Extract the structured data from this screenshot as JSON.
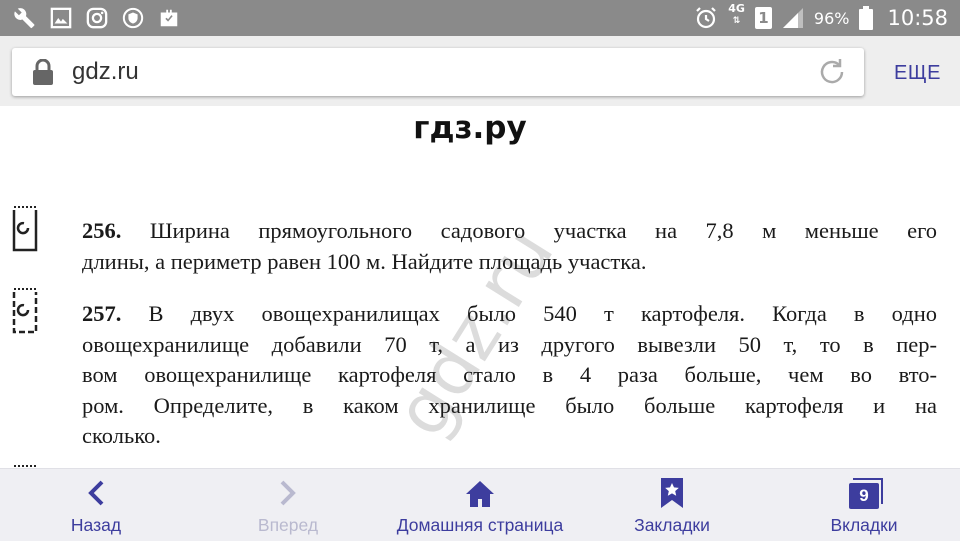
{
  "status_bar": {
    "network": "4G",
    "sim": "1",
    "battery": "96%",
    "time": "10:58",
    "icons": [
      "wrench-icon",
      "image-icon",
      "instagram-icon",
      "shield-icon",
      "briefcase-icon",
      "alarm-icon",
      "signal-icon",
      "battery-icon"
    ]
  },
  "toolbar": {
    "url": "gdz.ru",
    "more_label": "ЕЩЕ"
  },
  "page": {
    "site_title": "гдз.ру",
    "problems": [
      {
        "number": "256.",
        "lines": [
          "Ширина прямоугольного садового участка на 7,8 м меньше его",
          "длины, а периметр равен 100 м. Найдите площадь участка."
        ]
      },
      {
        "number": "257.",
        "lines": [
          "В двух овощехранилищах было 540 т картофеля. Когда в одно",
          "овощехранилище добавили 70 т, а из другого вывезли 50 т, то в пер-",
          "вом овощехранилище картофеля стало в 4 раза больше, чем во вто-",
          "ром. Определите, в каком хранилище было больше картофеля и на",
          "сколько."
        ]
      }
    ],
    "watermark": "gdz.ru"
  },
  "bottom_nav": {
    "back": "Назад",
    "forward": "Вперед",
    "home": "Домашняя страница",
    "bookmarks": "Закладки",
    "tabs": "Вкладки",
    "tab_count": "9"
  },
  "colors": {
    "accent": "#3d3d9e",
    "status_bar": "#8a8a8a",
    "toolbar": "#eeeeee",
    "nav_bg": "#efeff3",
    "disabled": "#b9b9cf"
  }
}
